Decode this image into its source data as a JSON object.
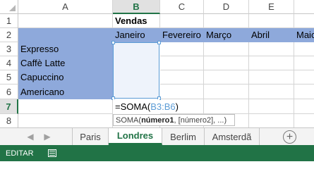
{
  "columns": [
    "A",
    "B",
    "C",
    "D",
    "E"
  ],
  "rows": [
    "1",
    "2",
    "3",
    "4",
    "5",
    "6",
    "7",
    "8"
  ],
  "cells": {
    "B1": "Vendas",
    "B2": "Janeiro",
    "C2": "Fevereiro",
    "D2": "Março",
    "E2": "Abril",
    "F2": "Maio",
    "A3": "Expresso",
    "A4": "Caffè Latte",
    "A5": "Capuccino",
    "A6": "Americano"
  },
  "formula": {
    "prefix": "=SOMA(",
    "range": "B3:B6",
    "suffix": ")"
  },
  "tooltip": {
    "func": "SOMA(",
    "arg1": "número1",
    "rest": ", [número2], ...)"
  },
  "nav": {
    "prev": "◀",
    "next": "▶"
  },
  "sheet_tabs": [
    "Paris",
    "Londres",
    "Berlim",
    "Amsterdã"
  ],
  "active_tab": "Londres",
  "add_sheet_label": "+",
  "status": {
    "mode": "EDITAR"
  },
  "colors": {
    "accent": "#217346",
    "header_fill": "#8ea9db",
    "range_border": "#5b9bd5"
  },
  "icons": [
    "select-all-triangle-icon",
    "prev-sheet-icon",
    "next-sheet-icon",
    "add-sheet-icon",
    "macro-record-icon"
  ]
}
